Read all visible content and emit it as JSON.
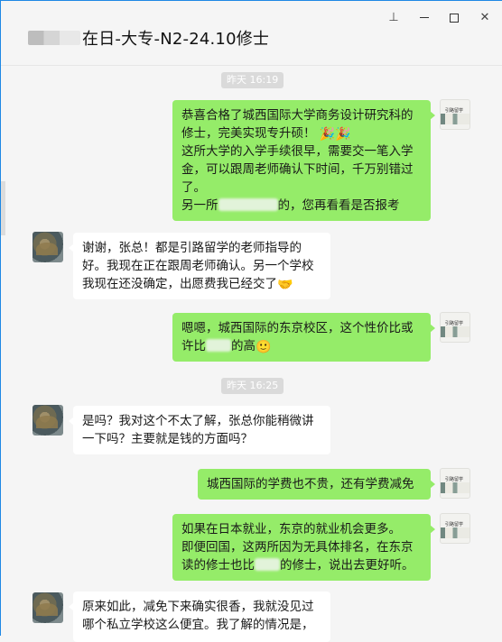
{
  "window": {
    "title": "在日-大专-N2-24.10修士",
    "controls": {
      "pin": "⊥",
      "minimize": "",
      "maximize": "",
      "close": "✕"
    }
  },
  "timestamps": [
    "昨天 16:19",
    "昨天 16:25"
  ],
  "messages": [
    {
      "side": "me",
      "lines": [
        "恭喜合格了城西国际大学商务设计研究科的",
        "修士，完美实现专升硕！",
        "这所大学的入学手续很早，需要交一笔入学",
        "金，可以跟周老师确认下时间，千万别错过",
        "了。"
      ],
      "line6_pre": "另一所",
      "line6_post": "的，您再看看是否报考",
      "emoji1": "🎉",
      "emoji2": "🎉"
    },
    {
      "side": "them",
      "lines": [
        "谢谢，张总！都是引路留学的老师指导的",
        "好。我现在正在跟周老师确认。另一个学校"
      ],
      "last_line": "我现在还没确定，出愿费我已经交了",
      "emoji": "🤝"
    },
    {
      "side": "me",
      "line1": "嗯嗯，城西国际的东京校区，这个性价比或",
      "line2_pre": "许比",
      "line2_post": "的高",
      "emoji": "🙂"
    },
    {
      "side": "them",
      "lines": [
        "是吗？我对这个不太了解，张总你能稍微讲",
        "一下吗？主要就是钱的方面吗？"
      ]
    },
    {
      "side": "me",
      "lines": [
        "城西国际的学费也不贵，还有学费减免"
      ]
    },
    {
      "side": "me",
      "lines": [
        "如果在日本就业，东京的就业机会更多。",
        "即便回国，这两所因为无具体排名，在东京"
      ],
      "line3_pre": "读的修士也比",
      "line3_post": "的修士，说出去更好听。"
    },
    {
      "side": "them",
      "lines": [
        "原来如此，减免下来确实很香，我就没见过",
        "哪个私立学校这么便宜。我了解的情况是，"
      ]
    }
  ],
  "avatar_me_text": "引路留学"
}
